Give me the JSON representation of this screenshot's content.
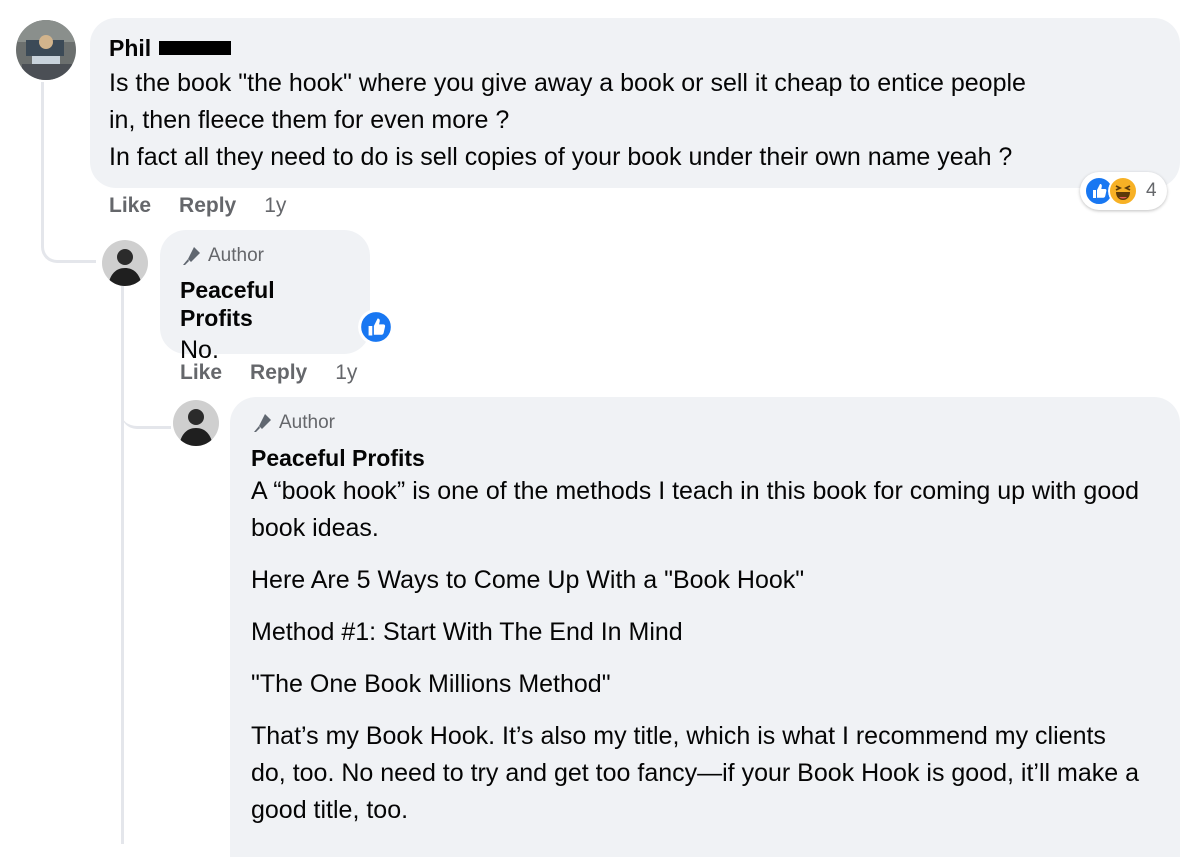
{
  "comments": [
    {
      "author": "Phil",
      "text_lines": [
        "Is the book \"the hook\" where you give away a book or sell it cheap to entice people",
        "in, then fleece them for even more ?",
        "In fact all they need to do is sell copies of your book under their own name yeah ?"
      ],
      "like_label": "Like",
      "reply_label": "Reply",
      "time": "1y",
      "reaction_count": "4",
      "reactions": [
        "like-reaction-icon",
        "haha-reaction-icon"
      ]
    },
    {
      "badge": "Author",
      "author": "Peaceful Profits",
      "text": "No.",
      "like_label": "Like",
      "reply_label": "Reply",
      "time": "1y",
      "reactions": [
        "like-reaction-icon"
      ]
    },
    {
      "badge": "Author",
      "author": "Peaceful Profits",
      "paragraphs": [
        "A “book hook” is one of the methods I teach in this book for coming up with good book ideas.",
        "Here Are 5 Ways to Come Up With a \"Book Hook\"",
        "Method #1: Start With The End In Mind",
        "\"The One Book Millions Method\"",
        "That’s my Book Hook. It’s also my title, which is what I recommend my clients do, too. No need to try and get too fancy—if your Book Hook is good, it’ll make a good title, too."
      ]
    }
  ],
  "colors": {
    "bubble_bg": "#f0f2f5",
    "meta_text": "#65676b",
    "like_blue": "#1877f2",
    "haha_yellow": "#f7b125"
  }
}
